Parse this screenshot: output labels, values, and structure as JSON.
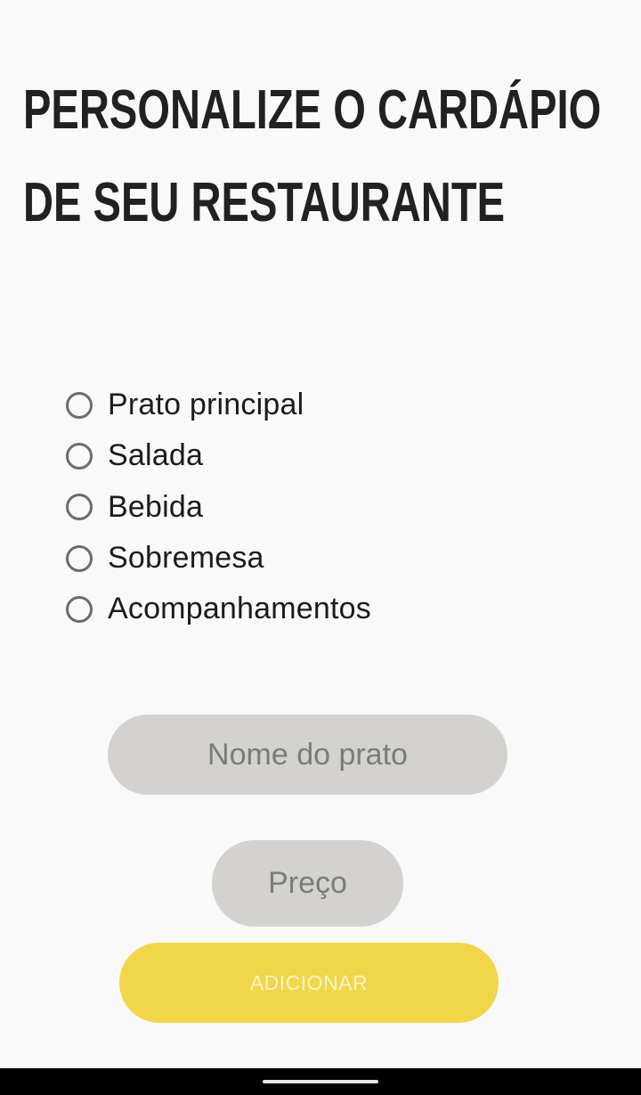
{
  "header": {
    "title_line1": "PERSONALIZE O CARDÁPIO",
    "title_line2": "DE SEU RESTAURANTE"
  },
  "categories": {
    "options": [
      {
        "label": "Prato principal",
        "checked": false
      },
      {
        "label": "Salada",
        "checked": false
      },
      {
        "label": "Bebida",
        "checked": false
      },
      {
        "label": "Sobremesa",
        "checked": false
      },
      {
        "label": "Acompanhamentos",
        "checked": false
      }
    ]
  },
  "form": {
    "dish_name_placeholder": "Nome do prato",
    "price_placeholder": "Preço",
    "add_label": "ADICIONAR"
  },
  "colors": {
    "background": "#f9f9f9",
    "title": "#212121",
    "input_background": "#d3d2cf",
    "button_background": "#f1d64a",
    "button_text": "#fbf4c9",
    "nav_bar": "#000000"
  }
}
